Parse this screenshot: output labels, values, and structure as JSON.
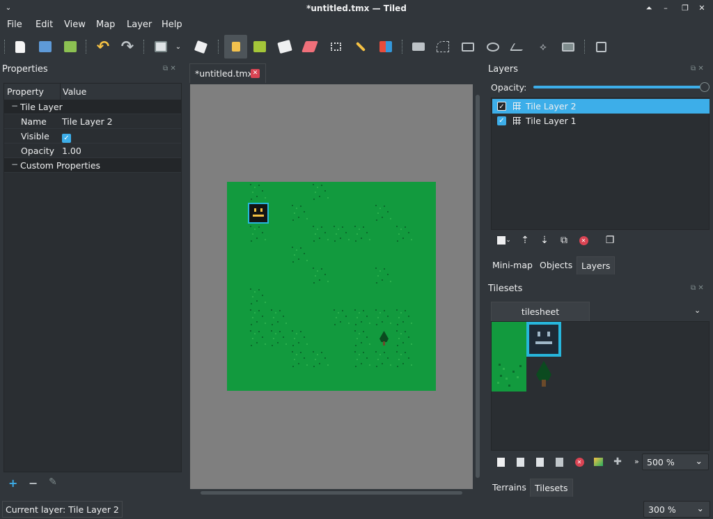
{
  "window": {
    "title": "*untitled.tmx — Tiled",
    "controls": [
      "⏶",
      "–",
      "❐",
      "✕"
    ]
  },
  "menu": [
    "File",
    "Edit",
    "View",
    "Map",
    "Layer",
    "Help"
  ],
  "toolbar": {
    "icons": [
      "new-map-icon",
      "open-icon",
      "save-icon",
      "undo-icon",
      "redo-icon",
      "commands-icon",
      "dropdown-arrow-icon",
      "random-mode-icon",
      "stamp-brush-icon",
      "terrain-brush-icon",
      "bucket-fill-icon",
      "eraser-icon",
      "rectangular-select-icon",
      "magic-wand-icon",
      "select-same-tile-icon",
      "select-objects-icon",
      "edit-polygons-icon",
      "insert-rectangle-icon",
      "insert-ellipse-icon",
      "insert-polygon-icon",
      "insert-polyline-icon",
      "insert-tile-icon",
      "fit-window-icon"
    ]
  },
  "properties": {
    "title": "Properties",
    "columns": [
      "Property",
      "Value"
    ],
    "group1": "Tile Layer",
    "rows": [
      {
        "key": "Name",
        "value": "Tile Layer 2"
      },
      {
        "key": "Visible",
        "value": "checked"
      },
      {
        "key": "Opacity",
        "value": "1.00"
      }
    ],
    "group2": "Custom Properties"
  },
  "editor": {
    "tab_label": "*untitled.tmx",
    "map": {
      "width_tiles": 10,
      "height_tiles": 10,
      "background": "#129a3e"
    }
  },
  "layers": {
    "title": "Layers",
    "opacity_label": "Opacity:",
    "opacity": 1.0,
    "items": [
      {
        "name": "Tile Layer 2",
        "visible": true,
        "selected": true
      },
      {
        "name": "Tile Layer 1",
        "visible": true,
        "selected": false
      }
    ]
  },
  "panel_tabs": [
    "Mini-map",
    "Objects",
    "Layers"
  ],
  "tilesets": {
    "title": "Tilesets",
    "tab": "tilesheet",
    "zoom": "500 %",
    "bottom_tabs": [
      "Terrains",
      "Tilesets"
    ]
  },
  "status": {
    "current_layer": "Current layer: Tile Layer 2",
    "zoom": "300 %"
  },
  "colors": {
    "accent": "#3daee9",
    "bg": "#31363b",
    "grass": "#129a3e",
    "smiley_border": "#27b6dc"
  }
}
